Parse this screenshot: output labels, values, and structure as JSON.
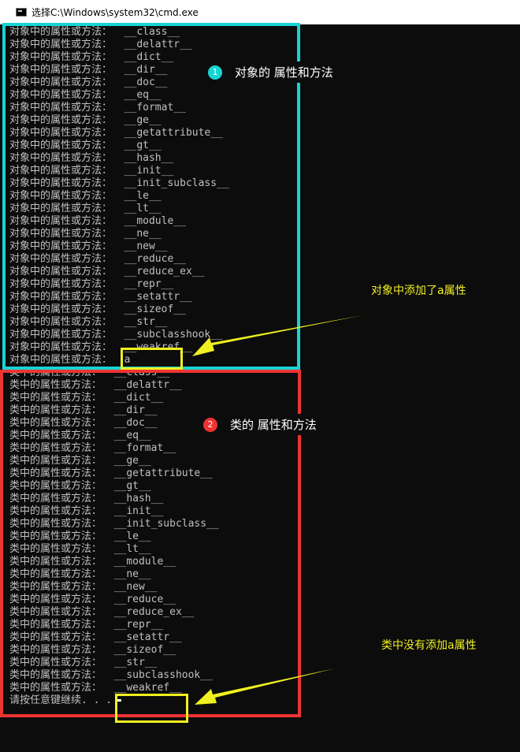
{
  "window": {
    "title": "选择C:\\Windows\\system32\\cmd.exe"
  },
  "console": {
    "object_prefix": "对象中的属性或方法：",
    "class_prefix": "类中的属性或方法：",
    "object_attrs": [
      "__class__",
      "__delattr__",
      "__dict__",
      "__dir__",
      "__doc__",
      "__eq__",
      "__format__",
      "__ge__",
      "__getattribute__",
      "__gt__",
      "__hash__",
      "__init__",
      "__init_subclass__",
      "__le__",
      "__lt__",
      "__module__",
      "__ne__",
      "__new__",
      "__reduce__",
      "__reduce_ex__",
      "__repr__",
      "__setattr__",
      "__sizeof__",
      "__str__",
      "__subclasshook__",
      "__weakref__",
      "a"
    ],
    "class_attrs": [
      "__class__",
      "__delattr__",
      "__dict__",
      "__dir__",
      "__doc__",
      "__eq__",
      "__format__",
      "__ge__",
      "__getattribute__",
      "__gt__",
      "__hash__",
      "__init__",
      "__init_subclass__",
      "__le__",
      "__lt__",
      "__module__",
      "__ne__",
      "__new__",
      "__reduce__",
      "__reduce_ex__",
      "__repr__",
      "__setattr__",
      "__sizeof__",
      "__str__",
      "__subclasshook__",
      "__weakref__"
    ],
    "prompt": "请按任意键继续. . ."
  },
  "annotations": {
    "object_badge": "1",
    "object_label": "对象的 属性和方法",
    "class_badge": "2",
    "class_label": "类的 属性和方法",
    "object_added_note": "对象中添加了a属性",
    "class_missing_note": "类中没有添加a属性"
  },
  "colors": {
    "console_bg": "#0c0c0c",
    "console_text": "#c0c0c0",
    "object_box": "#17d4d4",
    "class_box": "#ee3333",
    "highlight": "#f0f020",
    "badge1": "#17d4d4",
    "badge2": "#ee3333"
  }
}
